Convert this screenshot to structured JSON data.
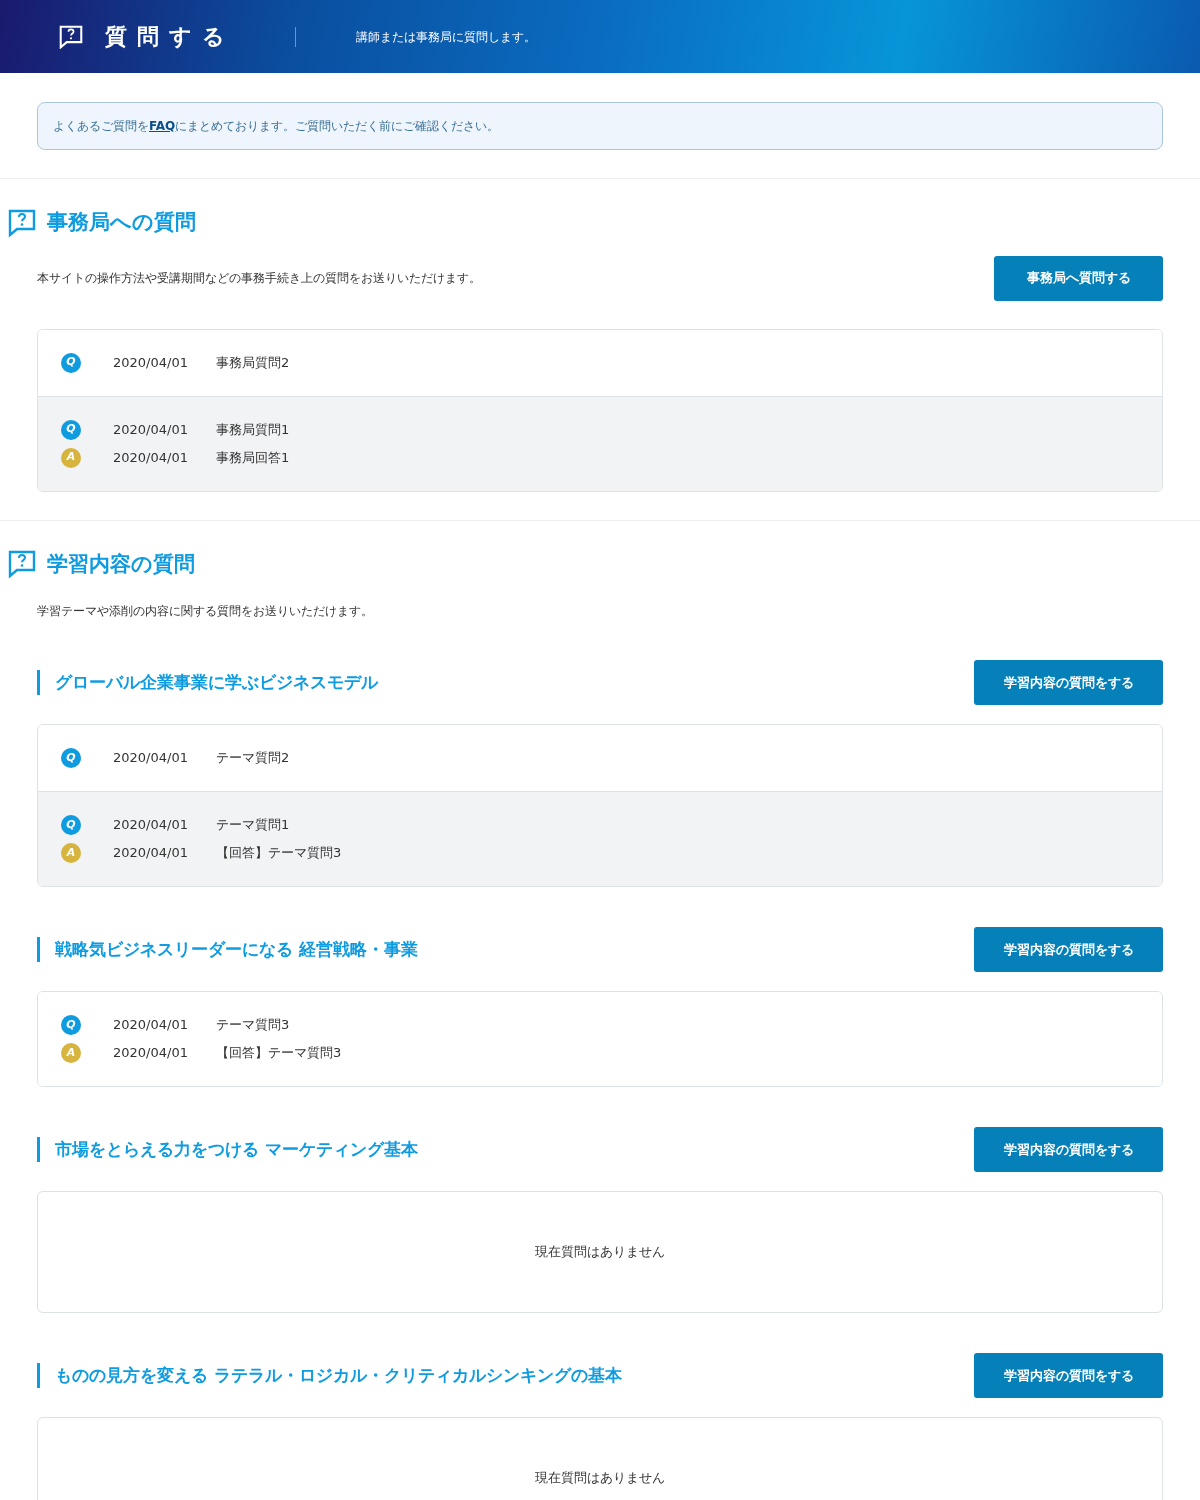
{
  "header": {
    "title": "質問する",
    "subtitle": "講師または事務局に質問します。"
  },
  "notice": {
    "before": "よくあるご質問を",
    "link": "FAQ",
    "after": "にまとめております。ご質問いただく前にご確認ください。"
  },
  "office_section": {
    "title": "事務局への質問",
    "description": "本サイトの操作方法や受講期間などの事務手続き上の質問をお送りいただけます。",
    "button": "事務局へ質問する",
    "threads": [
      {
        "highlighted": false,
        "entries": [
          {
            "kind": "question",
            "badge": "Q",
            "date": "2020/04/01",
            "text": "事務局質問2"
          }
        ]
      },
      {
        "highlighted": true,
        "entries": [
          {
            "kind": "question",
            "badge": "Q",
            "date": "2020/04/01",
            "text": "事務局質問1"
          },
          {
            "kind": "answer",
            "badge": "A",
            "date": "2020/04/01",
            "text": "事務局回答1"
          }
        ]
      }
    ]
  },
  "learning_section": {
    "title": "学習内容の質問",
    "description": "学習テーマや添削の内容に関する質問をお送りいただけます。",
    "themes": [
      {
        "title": "グローバル企業事業に学ぶビジネスモデル",
        "button": "学習内容の質問をする",
        "threads": [
          {
            "highlighted": false,
            "entries": [
              {
                "kind": "question",
                "badge": "Q",
                "date": "2020/04/01",
                "text": "テーマ質問2"
              }
            ]
          },
          {
            "highlighted": true,
            "entries": [
              {
                "kind": "question",
                "badge": "Q",
                "date": "2020/04/01",
                "text": "テーマ質問1"
              },
              {
                "kind": "answer",
                "badge": "A",
                "date": "2020/04/01",
                "text": "【回答】テーマ質問3"
              }
            ]
          }
        ]
      },
      {
        "title": "戦略気ビジネスリーダーになる 経営戦略・事業",
        "button": "学習内容の質問をする",
        "threads": [
          {
            "highlighted": false,
            "entries": [
              {
                "kind": "question",
                "badge": "Q",
                "date": "2020/04/01",
                "text": "テーマ質問3"
              },
              {
                "kind": "answer",
                "badge": "A",
                "date": "2020/04/01",
                "text": "【回答】テーマ質問3"
              }
            ]
          }
        ]
      },
      {
        "title": "市場をとらえる力をつける マーケティング基本",
        "button": "学習内容の質問をする",
        "empty_message": "現在質問はありません"
      },
      {
        "title": "ものの見方を変える ラテラル・ロジカル・クリティカルシンキングの基本",
        "button": "学習内容の質問をする",
        "empty_message": "現在質問はありません"
      }
    ]
  }
}
